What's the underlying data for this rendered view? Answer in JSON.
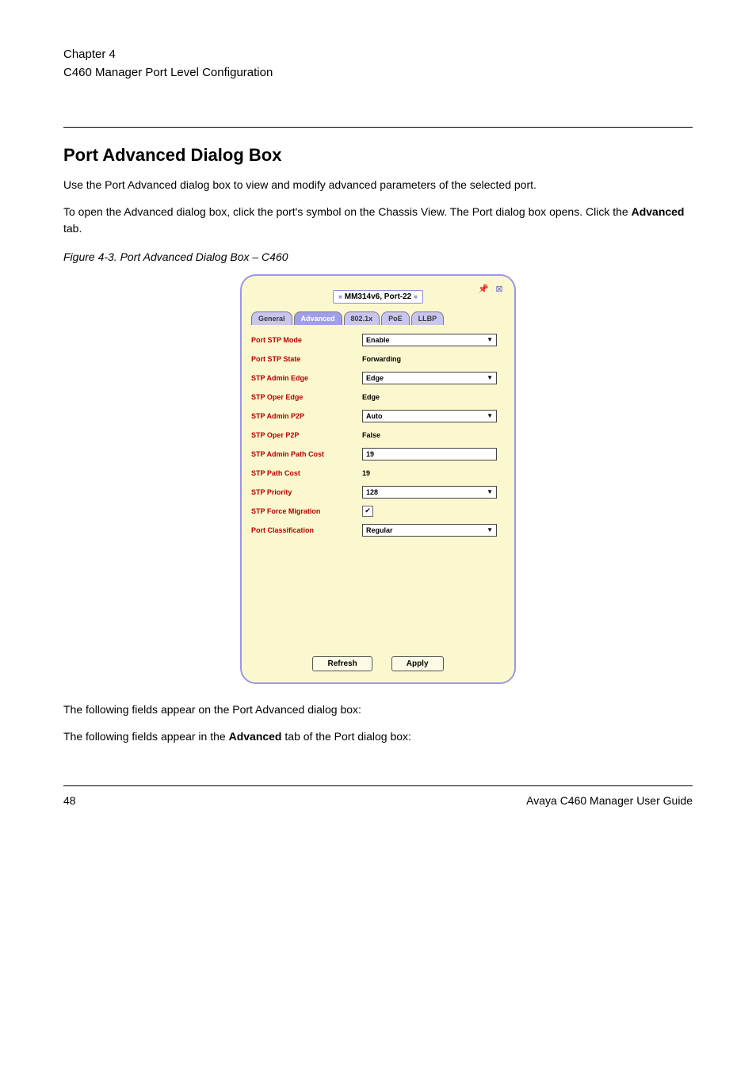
{
  "header": {
    "chapter_ref": "Chapter 4",
    "chapter_title": "C460 Manager Port Level Configuration"
  },
  "section": {
    "title": "Port Advanced Dialog Box",
    "intro": "Use the Port Advanced dialog box to view and modify advanced parameters of the selected port.",
    "open_instr": "To open the Advanced dialog box, click the port's symbol on the Chassis View. The Port dialog box opens. Click the",
    "open_instr_bold": "Advanced",
    "open_instr_tail": "tab."
  },
  "figure_caption": "Figure 4-3. Port Advanced Dialog Box – C460",
  "screenshot": {
    "title": "MM314v6, Port-22",
    "tabs": [
      "General",
      "Advanced",
      "802.1x",
      "PoE",
      "LLBP"
    ],
    "active_tab_index": 1,
    "rows": [
      {
        "label": "Port STP Mode",
        "type": "select",
        "value": "Enable"
      },
      {
        "label": "Port STP State",
        "type": "static",
        "value": "Forwarding"
      },
      {
        "label": "STP Admin Edge",
        "type": "select",
        "value": "Edge"
      },
      {
        "label": "STP Oper Edge",
        "type": "static",
        "value": "Edge"
      },
      {
        "label": "STP Admin P2P",
        "type": "select",
        "value": "Auto"
      },
      {
        "label": "STP Oper P2P",
        "type": "static",
        "value": "False"
      },
      {
        "label": "STP Admin Path Cost",
        "type": "text",
        "value": "19"
      },
      {
        "label": "STP Path Cost",
        "type": "static",
        "value": "19"
      },
      {
        "label": "STP Priority",
        "type": "select",
        "value": "128"
      },
      {
        "label": "STP Force Migration",
        "type": "checkbox",
        "value": "checked"
      },
      {
        "label": "Port Classification",
        "type": "select",
        "value": "Regular"
      }
    ],
    "buttons": {
      "refresh": "Refresh",
      "apply": "Apply"
    }
  },
  "post_figure": {
    "para1": "The following fields appear on the Port Advanced dialog box:",
    "para2_lead": "The following fields appear in the",
    "para2_bold": "Advanced",
    "para2_tail": "tab of the Port dialog box:"
  },
  "footer": {
    "left": "48",
    "right": "Avaya C460 Manager User Guide"
  }
}
